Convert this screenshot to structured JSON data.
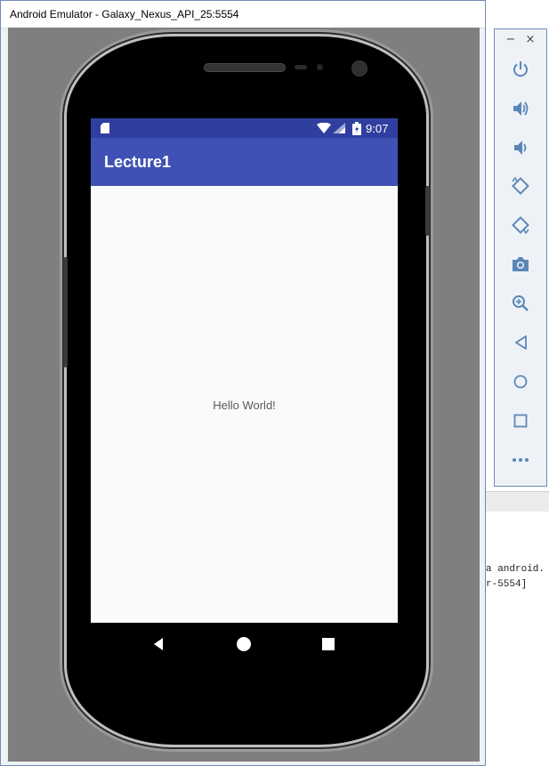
{
  "window": {
    "title": "Android Emulator - Galaxy_Nexus_API_25:5554"
  },
  "phone": {
    "status_bar": {
      "time": "9:07",
      "icons": [
        "sd-card-icon",
        "wifi-icon",
        "signal-icon",
        "battery-charging-icon"
      ]
    },
    "app_bar": {
      "title": "Lecture1"
    },
    "content": {
      "text": "Hello World!"
    },
    "nav_bar": [
      "back-icon",
      "home-icon",
      "recents-icon"
    ]
  },
  "toolbar": {
    "window_buttons": {
      "minimize": "−",
      "close": "×"
    },
    "tools": [
      "power-icon",
      "volume-up-icon",
      "volume-down-icon",
      "rotate-left-icon",
      "rotate-right-icon",
      "screenshot-icon",
      "zoom-icon",
      "back-icon",
      "home-icon",
      "overview-icon",
      "more-icon"
    ]
  },
  "background": {
    "console_lines": [
      "a android.",
      "r-5554]"
    ]
  },
  "colors": {
    "status_bar": "#303f9f",
    "app_bar": "#3f51b5",
    "emulator_bg": "#7f7f7f",
    "toolbar_icon": "#5b87b7"
  }
}
